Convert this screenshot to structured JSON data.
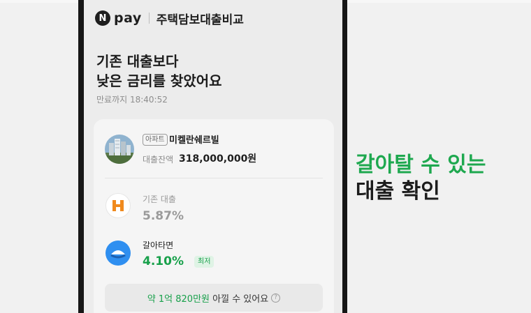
{
  "header": {
    "logo_letter": "N",
    "logo_word": "pay",
    "title": "주택담보대출비교"
  },
  "headline": {
    "line1": "기존 대출보다",
    "line2": "낮은 금리를 찾았어요"
  },
  "expiry_text": "만료까지 18:40:52",
  "property": {
    "type_badge": "아파트",
    "name": "미켈란쉐르빌",
    "balance_label": "대출잔액",
    "balance_value": "318,000,000원"
  },
  "existing_loan": {
    "label": "기존 대출",
    "rate": "5.87%",
    "bank_logo_letter": "H",
    "bank_logo_color": "#f08a1e"
  },
  "switch_loan": {
    "label": "갈아타면",
    "rate": "4.10%",
    "badge": "최저"
  },
  "savings": {
    "amount": "약 1억 820만원",
    "suffix": "아낄 수 있어요",
    "info_icon": "question-circle-icon"
  },
  "promo": {
    "line1": "갈아탈 수 있는",
    "line2": "대출 확인"
  },
  "colors": {
    "accent_green": "#1ea84f",
    "bezel": "#161616",
    "switch_logo_blue": "#2f8ff0"
  }
}
